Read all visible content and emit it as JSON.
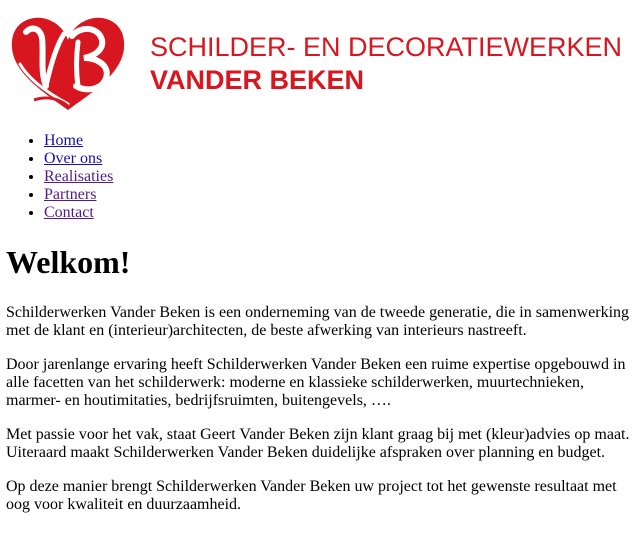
{
  "header": {
    "brand_line1": "SCHILDER- EN DECORATIEWERKEN",
    "brand_line2": "VANDER BEKEN",
    "logo_icon": "vb-monogram-logo",
    "brand_color": "#d8161f"
  },
  "nav": {
    "items": [
      {
        "label": "Home"
      },
      {
        "label": "Over ons"
      },
      {
        "label": "Realisaties"
      },
      {
        "label": "Partners"
      },
      {
        "label": "Contact"
      }
    ]
  },
  "main": {
    "heading": "Welkom!",
    "paragraphs": [
      "Schilderwerken Vander Beken is een onderneming van de tweede generatie, die in samenwerking met de klant en (interieur)architecten, de beste afwerking van interieurs nastreeft.",
      "Door jarenlange ervaring heeft Schilderwerken Vander Beken een ruime expertise opgebouwd in alle facetten van het schilderwerk: moderne en klassieke schilderwerken, muurtechnieken, marmer- en houtimitaties, bedrijfsruimten, buitengevels, ….",
      "Met passie voor het vak, staat Geert Vander Beken zijn klant graag bij met (kleur)advies op maat. Uiteraard maakt Schilderwerken Vander Beken duidelijke afspraken over planning en budget.",
      "Op deze manier brengt Schilderwerken Vander Beken uw project tot het gewenste resultaat met oog voor kwaliteit en duurzaamheid."
    ]
  }
}
